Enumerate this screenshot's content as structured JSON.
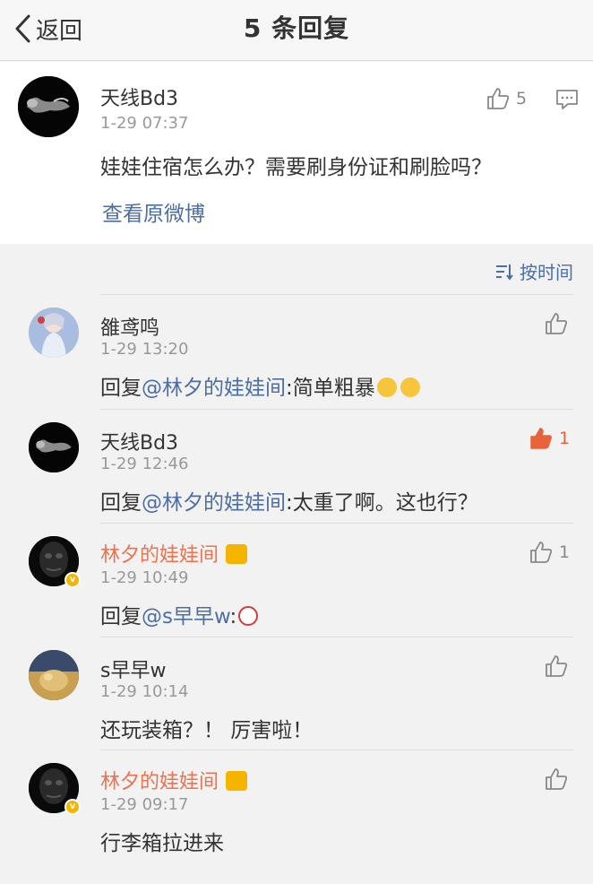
{
  "nav": {
    "back_label": "返回",
    "title": "5 条回复"
  },
  "original": {
    "username": "天线Bd3",
    "time": "1-29 07:37",
    "text": "娃娃住宿怎么办？需要刷身份证和刷脸吗？",
    "likes": "5",
    "view_original": "查看原微博"
  },
  "sort": {
    "label": "按时间"
  },
  "replies": [
    {
      "username": "雒鸢鸣",
      "time": "1-29 13:20",
      "prefix": "回复",
      "mention": "@林夕的娃娃间",
      "text": ":简单粗暴",
      "likes": ""
    },
    {
      "username": "天线Bd3",
      "time": "1-29 12:46",
      "prefix": "回复",
      "mention": "@林夕的娃娃间",
      "text": ":太重了啊。这也行？",
      "likes": "1"
    },
    {
      "username": "林夕的娃娃间",
      "time": "1-29 10:49",
      "prefix": "回复",
      "mention": "@s早早w",
      "text": ":",
      "likes": "1"
    },
    {
      "username": "s早早w",
      "time": "1-29 10:14",
      "prefix": "",
      "mention": "",
      "text": "还玩装箱？！ 厉害啦！",
      "likes": ""
    },
    {
      "username": "林夕的娃娃间",
      "time": "1-29 09:17",
      "prefix": "",
      "mention": "",
      "text": "行李箱拉进来",
      "likes": ""
    }
  ],
  "colors": {
    "link": "#4b6ea9",
    "vip_name": "#eb7350",
    "liked": "#e8623a"
  }
}
